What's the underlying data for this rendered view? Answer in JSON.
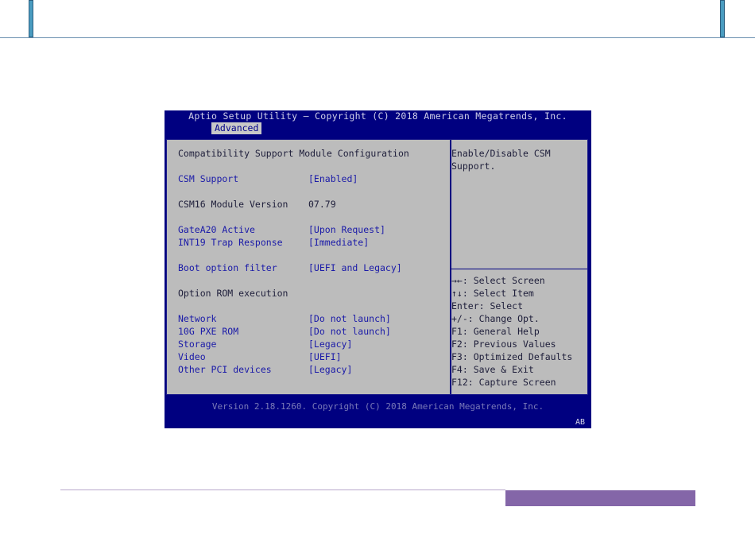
{
  "bios": {
    "title": "Aptio Setup Utility – Copyright (C) 2018 American Megatrends, Inc.",
    "active_tab": "Advanced",
    "section_title": "Compatibility Support Module Configuration",
    "items": [
      {
        "label": "CSM Support",
        "value": "[Enabled]"
      },
      {
        "label": "CSM16 Module Version",
        "value": "07.79"
      },
      {
        "label": "GateA20 Active",
        "value": "[Upon Request]"
      },
      {
        "label": "INT19 Trap Response",
        "value": "[Immediate]"
      },
      {
        "label": "Boot option filter",
        "value": "[UEFI and Legacy]"
      },
      {
        "label": "Option ROM execution",
        "value": ""
      },
      {
        "label": "Network",
        "value": "[Do not launch]"
      },
      {
        "label": "10G PXE ROM",
        "value": "[Do not launch]"
      },
      {
        "label": "Storage",
        "value": "[Legacy]"
      },
      {
        "label": "Video",
        "value": "[UEFI]"
      },
      {
        "label": "Other PCI devices",
        "value": "[Legacy]"
      }
    ],
    "help_text_1": "Enable/Disable CSM",
    "help_text_2": "Support.",
    "keys": [
      "→←: Select Screen",
      "↑↓: Select Item",
      "Enter: Select",
      "+/-: Change Opt.",
      "F1: General Help",
      "F2: Previous Values",
      "F3: Optimized Defaults",
      "F4: Save & Exit",
      "F12: Capture Screen"
    ],
    "footer": "Version 2.18.1260. Copyright (C) 2018 American Megatrends, Inc.",
    "badge": "AB"
  }
}
